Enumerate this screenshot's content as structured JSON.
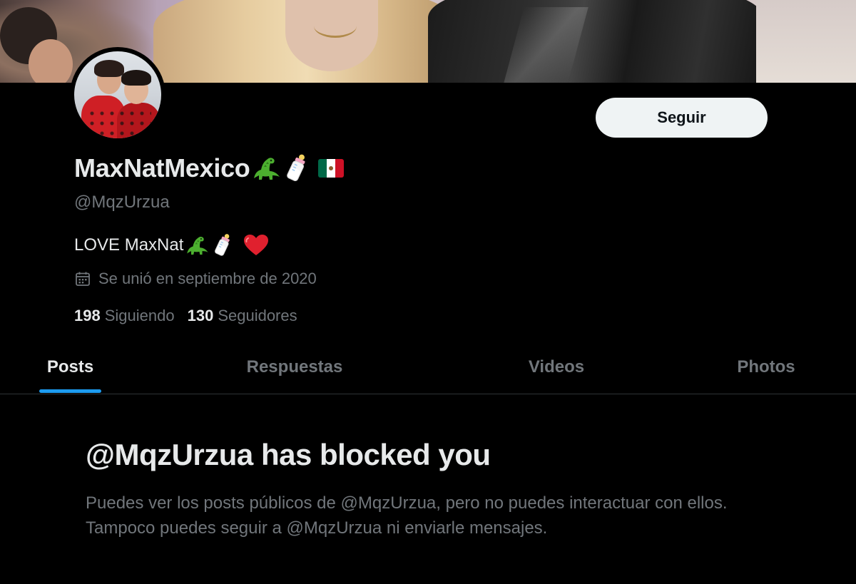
{
  "profile": {
    "display_name": "MaxNatMexico",
    "handle": "@MqzUrzua",
    "bio_text": "LOVE MaxNat",
    "joined": "Se unió en septiembre de 2020",
    "following_count": "198",
    "following_label": "Siguiendo",
    "followers_count": "130",
    "followers_label": "Seguidores",
    "name_emojis": [
      "dinosaur-icon",
      "baby-bottle-icon",
      "mexico-flag-icon"
    ],
    "bio_emojis": [
      "dinosaur-icon",
      "baby-bottle-icon",
      "red-heart-icon"
    ]
  },
  "actions": {
    "follow_label": "Seguir"
  },
  "tabs": [
    {
      "label": "Posts",
      "active": true
    },
    {
      "label": "Respuestas",
      "active": false
    },
    {
      "label": "Videos",
      "active": false
    },
    {
      "label": "Photos",
      "active": false
    }
  ],
  "blocked": {
    "title": "@MqzUrzua has blocked you",
    "message": "Puedes ver los posts públicos de @MqzUrzua, pero no puedes interactuar con ellos. Tampoco puedes seguir a @MqzUrzua ni enviarle mensajes."
  },
  "colors": {
    "background": "#000000",
    "primary_text": "#e7e9ea",
    "secondary_text": "#71767b",
    "accent": "#1d9bf0",
    "button_bg": "#eff3f4",
    "divider": "#2f3336"
  }
}
